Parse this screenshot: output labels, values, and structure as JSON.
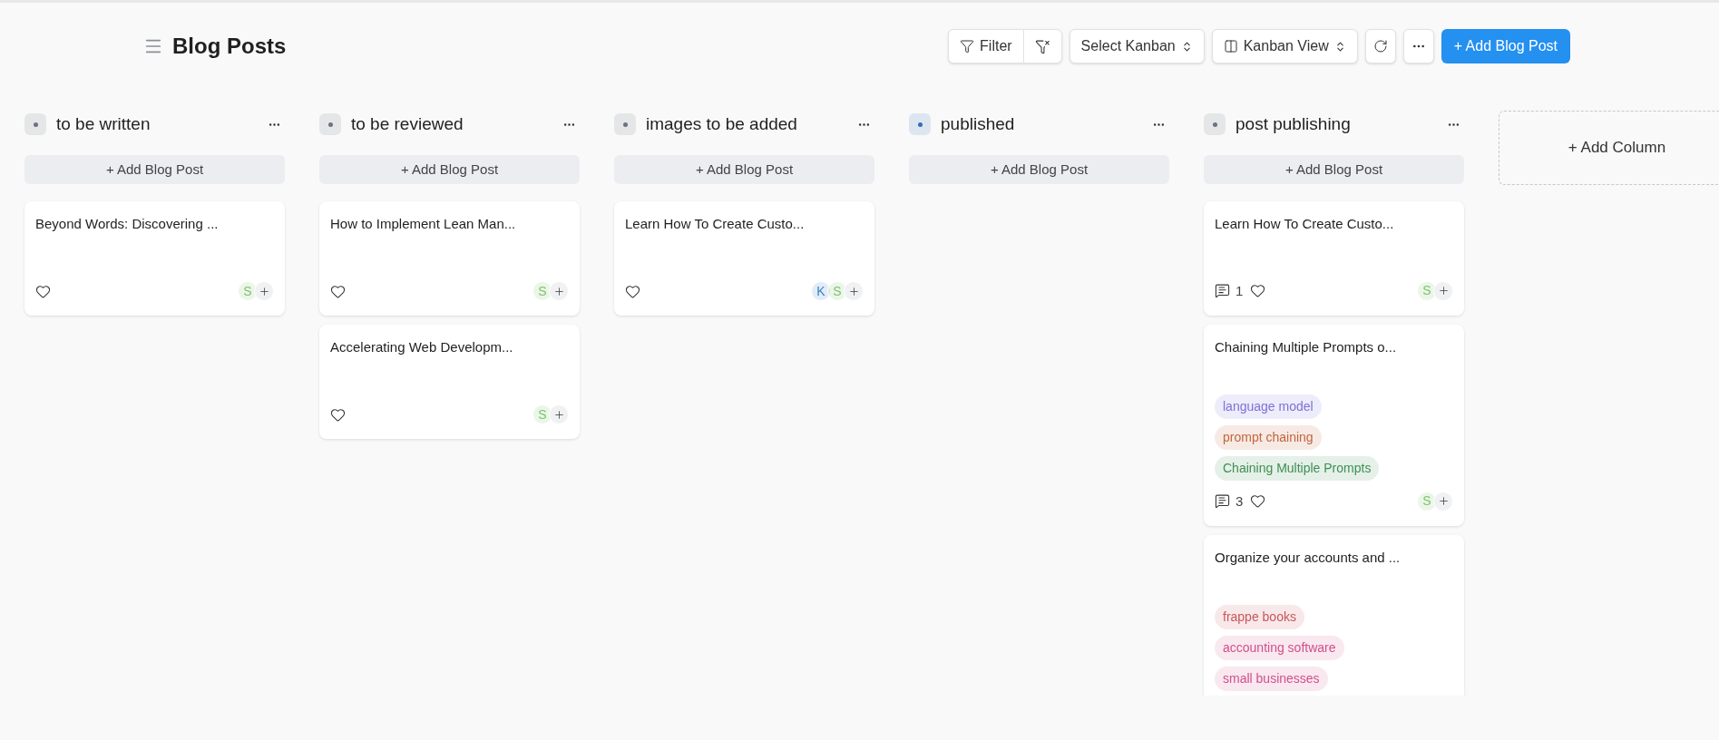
{
  "header": {
    "title": "Blog Posts",
    "filter_label": "Filter",
    "select_kanban": "Select Kanban",
    "view_label": "Kanban View",
    "add_button": "+ Add Blog Post"
  },
  "columns": [
    {
      "title": "to be written",
      "color": "#6b7280",
      "add_label": "+ Add Blog Post",
      "cards": [
        {
          "title": "Beyond Words: Discovering ...",
          "assignees": [
            {
              "initial": "S",
              "color": "#7cc36b"
            }
          ]
        }
      ]
    },
    {
      "title": "to be reviewed",
      "color": "#6b7280",
      "add_label": "+ Add Blog Post",
      "cards": [
        {
          "title": "How to Implement Lean Man...",
          "assignees": [
            {
              "initial": "S",
              "color": "#7cc36b"
            }
          ]
        },
        {
          "title": "Accelerating Web Developm...",
          "assignees": [
            {
              "initial": "S",
              "color": "#7cc36b"
            }
          ]
        }
      ]
    },
    {
      "title": "images to be added",
      "color": "#6b7280",
      "add_label": "+ Add Blog Post",
      "cards": [
        {
          "title": "Learn How To Create Custo...",
          "assignees": [
            {
              "initial": "K",
              "color": "#3b82c4"
            },
            {
              "initial": "S",
              "color": "#7cc36b"
            }
          ]
        }
      ]
    },
    {
      "title": "published",
      "color": "#2f6fb8",
      "add_label": "+ Add Blog Post"
    },
    {
      "title": "post publishing",
      "color": "#6b7280",
      "add_label": "+ Add Blog Post",
      "cards": [
        {
          "title": "Learn How To Create Custo...",
          "comments": "1",
          "assignees": [
            {
              "initial": "S",
              "color": "#7cc36b"
            }
          ]
        },
        {
          "title": "Chaining Multiple Prompts o...",
          "comments": "3",
          "tags": [
            {
              "label": "language model",
              "color": "#7b72d8"
            },
            {
              "label": "prompt chaining",
              "color": "#c2653c"
            },
            {
              "label": "Chaining Multiple Prompts",
              "color": "#3f8f55"
            }
          ],
          "assignees": [
            {
              "initial": "S",
              "color": "#7cc36b"
            }
          ]
        },
        {
          "title": "Organize your accounts and ...",
          "tags": [
            {
              "label": "frappe books",
              "color": "#c9565a"
            },
            {
              "label": "accounting software",
              "color": "#d0508a"
            },
            {
              "label": "small businesses",
              "color": "#d0508a"
            }
          ]
        }
      ]
    }
  ],
  "add_column": "+ Add Column"
}
